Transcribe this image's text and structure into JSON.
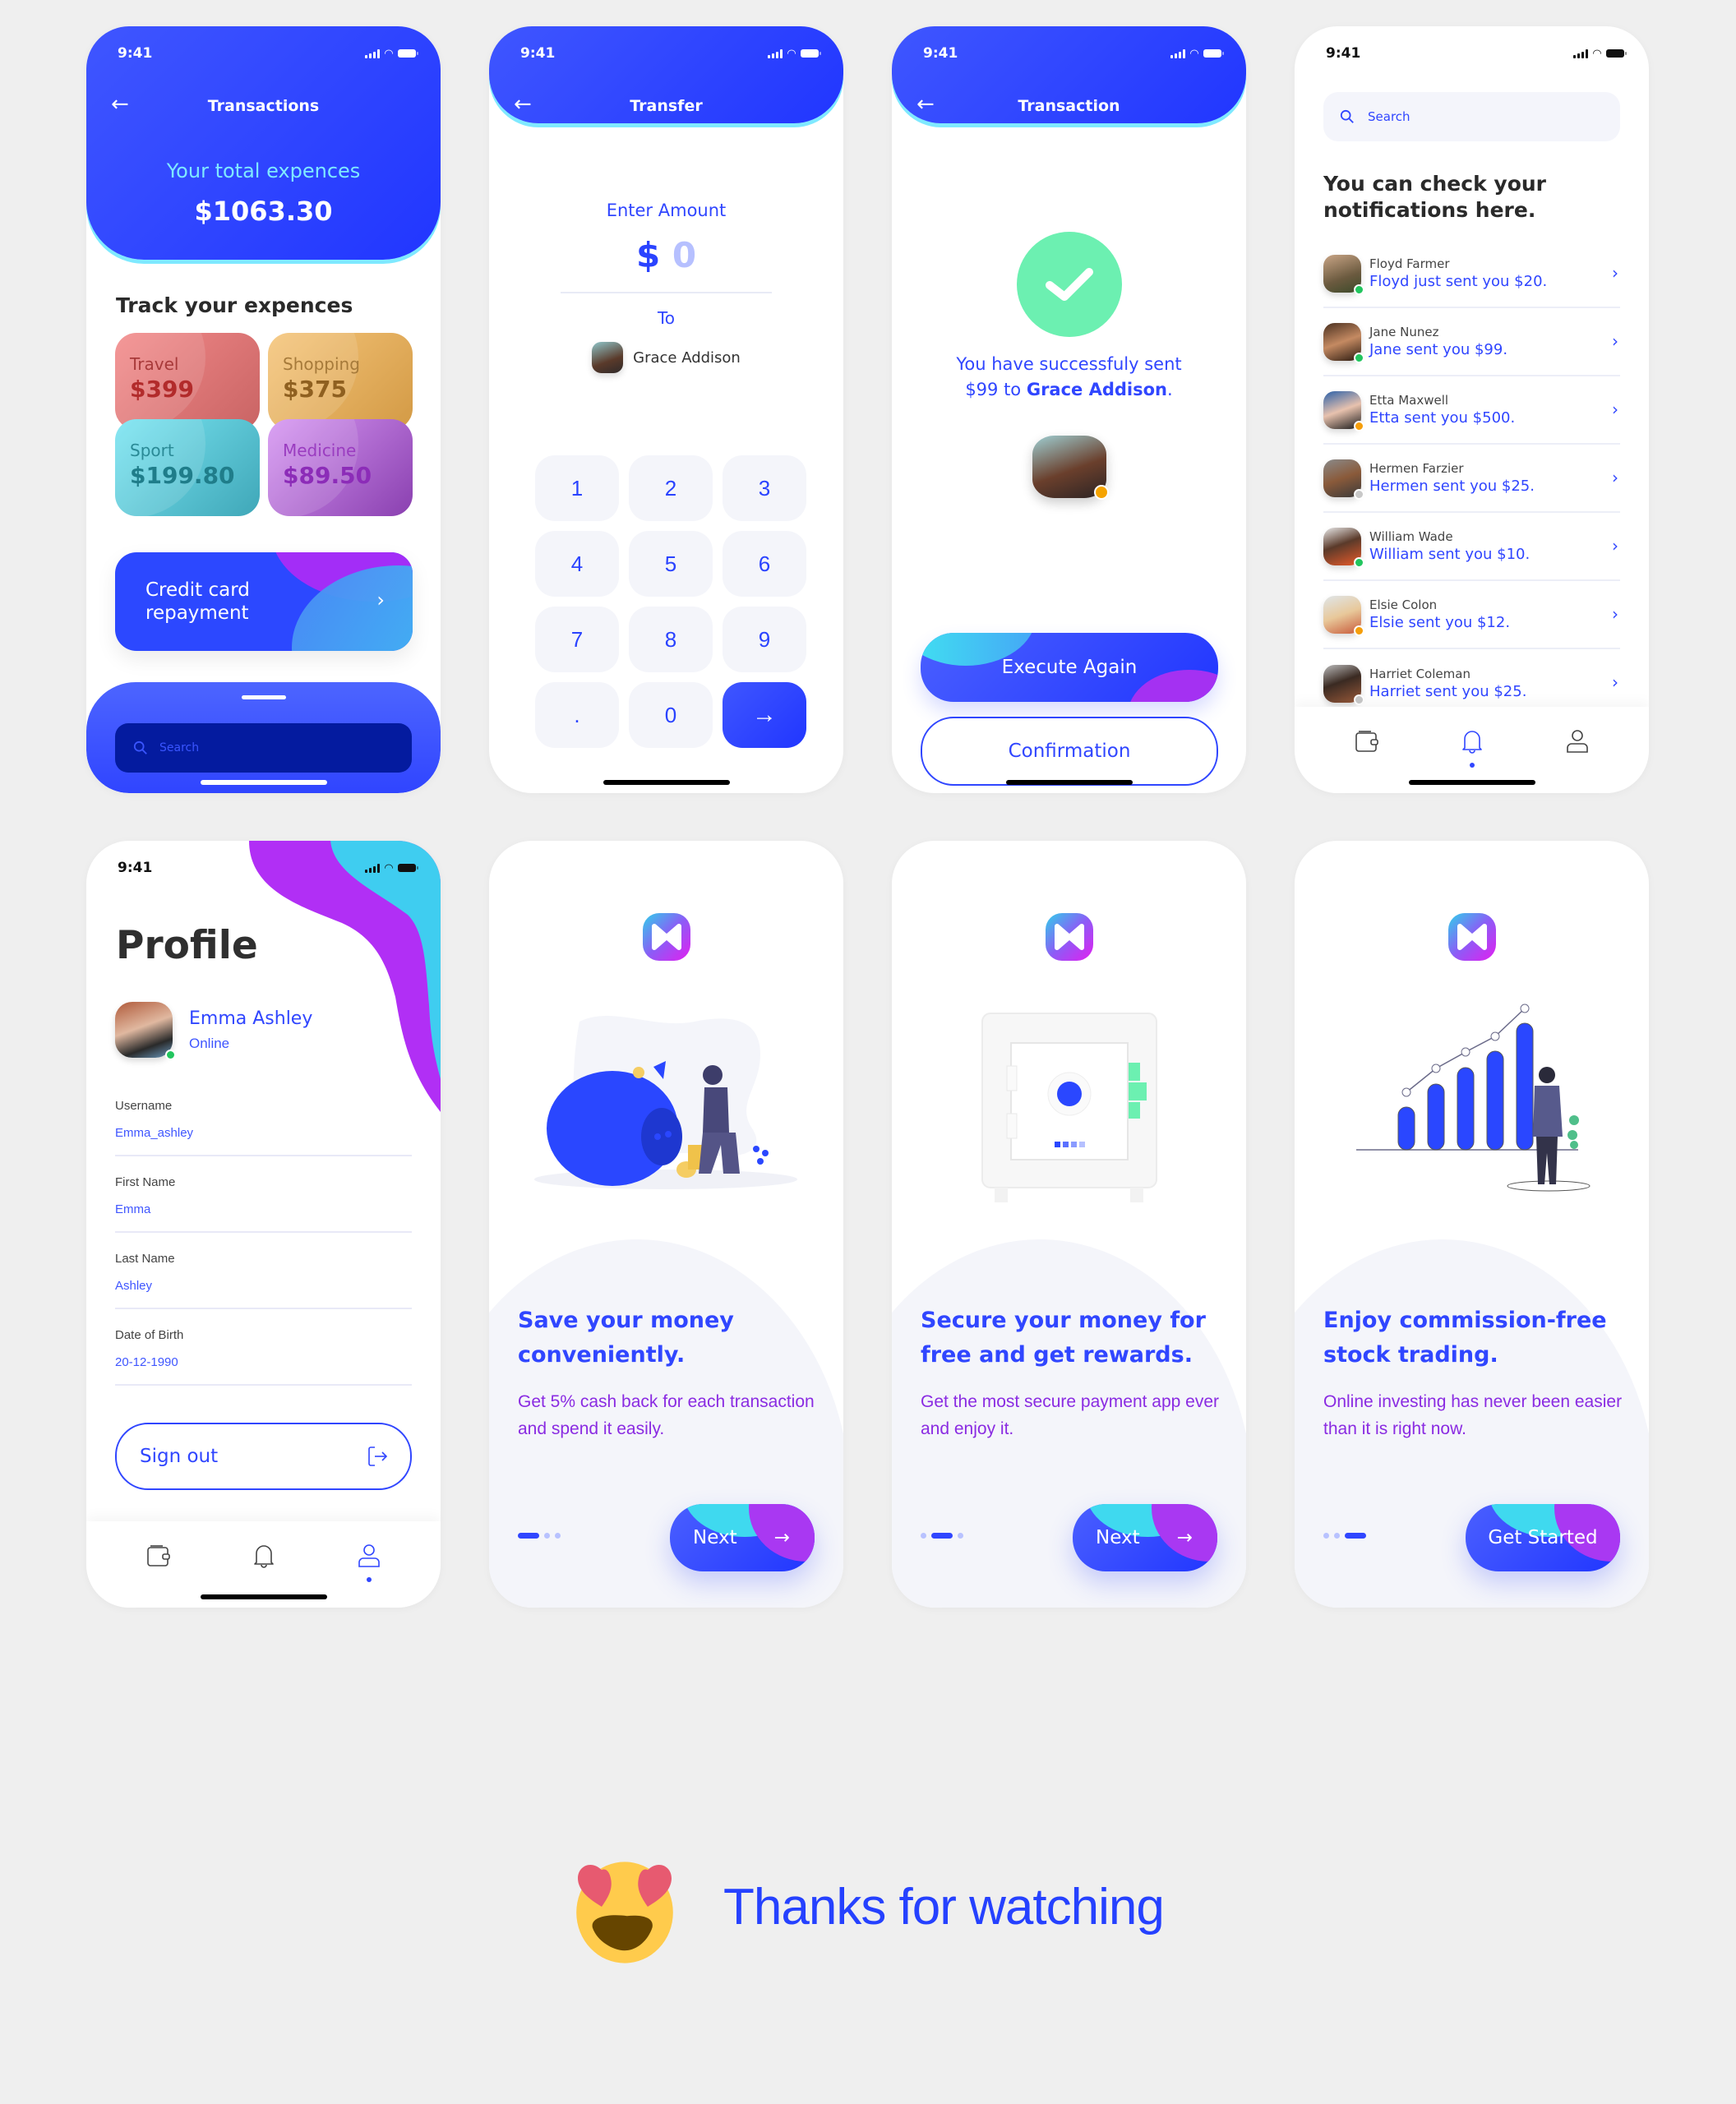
{
  "status_bar": {
    "time": "9:41"
  },
  "colors": {
    "primary": "#2a43ff",
    "accent_cyan": "#7fe9ff",
    "accent_purple": "#a32df7",
    "success": "#6cf0b1",
    "online": "#22c55e",
    "away": "#f59e0b",
    "offline": "#c8c8c8"
  },
  "transactions_screen": {
    "title": "Transactions",
    "total_label": "Your total expences",
    "total_value": "$1063.30",
    "track_title": "Track your expences",
    "categories": [
      {
        "label": "Travel",
        "value": "$399"
      },
      {
        "label": "Shopping",
        "value": "$375"
      },
      {
        "label": "Sport",
        "value": "$199.80"
      },
      {
        "label": "Medicine",
        "value": "$89.50"
      }
    ],
    "credit_card": {
      "line1": "Credit card",
      "line2": "repayment",
      "chevron": "›"
    },
    "search_placeholder": "Search"
  },
  "transfer_screen": {
    "title": "Transfer",
    "enter_amount_label": "Enter Amount",
    "currency": "$",
    "amount": "0",
    "to_label": "To",
    "recipient": "Grace Addison",
    "keypad": [
      "1",
      "2",
      "3",
      "4",
      "5",
      "6",
      "7",
      "8",
      "9",
      ".",
      "0"
    ],
    "submit_icon": "→"
  },
  "transaction_screen": {
    "title": "Transaction",
    "message_line1": "You have successfuly sent",
    "message_amount": "$99 to ",
    "message_recipient": "Grace Addison",
    "message_end": ".",
    "execute_button": "Execute Again",
    "confirm_button": "Confirmation"
  },
  "notifications_screen": {
    "search_placeholder": "Search",
    "heading_line1": "You can check your",
    "heading_line2": "notifications here.",
    "items": [
      {
        "name": "Floyd Farmer",
        "message": "Floyd just sent you $20.",
        "status": "online"
      },
      {
        "name": "Jane Nunez",
        "message": "Jane sent you $99.",
        "status": "online"
      },
      {
        "name": "Etta Maxwell",
        "message": "Etta sent you $500.",
        "status": "away"
      },
      {
        "name": "Hermen Farzier",
        "message": "Hermen sent you $25.",
        "status": "offline"
      },
      {
        "name": "William Wade",
        "message": "William sent you $10.",
        "status": "online"
      },
      {
        "name": "Elsie Colon",
        "message": "Elsie sent you $12.",
        "status": "away"
      },
      {
        "name": "Harriet Coleman",
        "message": "Harriet sent you $25.",
        "status": "offline"
      }
    ],
    "active_tab": "notifications"
  },
  "profile_screen": {
    "title": "Profile",
    "user_name": "Emma Ashley",
    "user_status": "Online",
    "fields": [
      {
        "label": "Username",
        "value": "Emma_ashley"
      },
      {
        "label": "First Name",
        "value": "Emma"
      },
      {
        "label": "Last Name",
        "value": "Ashley"
      },
      {
        "label": "Date of Birth",
        "value": "20-12-1990"
      }
    ],
    "sign_out_button": "Sign out",
    "active_tab": "profile"
  },
  "tabs": [
    "wallet",
    "notifications",
    "profile"
  ],
  "onboarding": [
    {
      "title": "Save your money conveniently.",
      "text": "Get 5% cash back for each transaction and spend it easily.",
      "button": "Next",
      "button_icon": "→",
      "page": 1,
      "pages": 3
    },
    {
      "title": "Secure your money for free and get rewards.",
      "text": "Get the most secure payment app ever and enjoy it.",
      "button": "Next",
      "button_icon": "→",
      "page": 2,
      "pages": 3
    },
    {
      "title": "Enjoy commission-free stock trading.",
      "text": "Online investing has never been easier than it is right now.",
      "button": "Get Started",
      "button_icon": "",
      "page": 3,
      "pages": 3
    }
  ],
  "footer": {
    "emoji": "heart-eyes",
    "text": "Thanks for watching"
  }
}
